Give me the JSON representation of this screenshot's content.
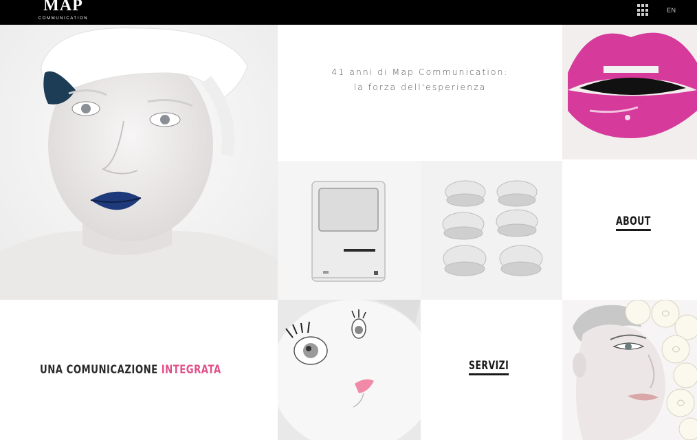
{
  "header": {
    "logo_main": "MAP",
    "logo_sub": "COMMUNICATION",
    "menu_icon": "grid-menu-icon",
    "language": "EN"
  },
  "intro": {
    "line1": "41 anni di Map Communication:",
    "line2": "la forza dell'esperienza"
  },
  "tiles": {
    "about_label": "ABOUT",
    "servizi_label": "SERVIZI",
    "integrata_prefix": "UNA COMUNICAZIONE",
    "integrata_accent": "INTEGRATA"
  },
  "colors": {
    "header_bg": "#000000",
    "accent_pink": "#e0508a",
    "lips_magenta": "#d63a9a",
    "lips_blue": "#1e3a7a"
  }
}
